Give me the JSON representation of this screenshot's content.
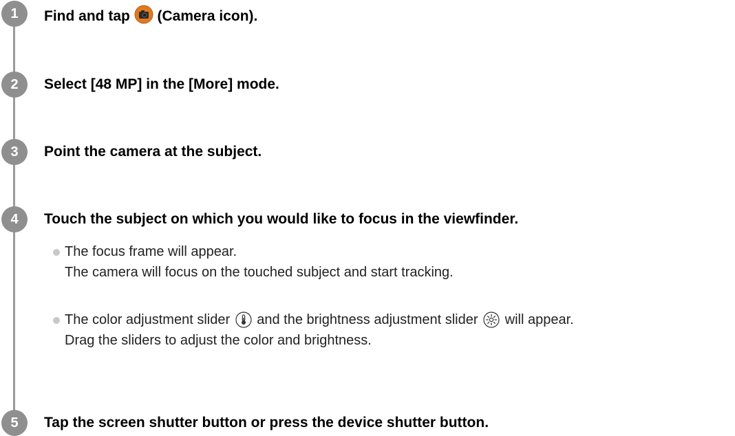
{
  "steps": [
    {
      "number": "1",
      "title_before": "Find and tap ",
      "title_icon": "camera-app-icon",
      "title_after": " (Camera icon)."
    },
    {
      "number": "2",
      "title": "Select [48 MP] in the [More] mode."
    },
    {
      "number": "3",
      "title": "Point the camera at the subject."
    },
    {
      "number": "4",
      "title": "Touch the subject on which you would like to focus in the viewfinder.",
      "bullets": [
        {
          "line1": "The focus frame will appear.",
          "line2": "The camera will focus on the touched subject and start tracking."
        },
        {
          "line1_part1": "The color adjustment slider ",
          "icon1": "thermometer-icon",
          "line1_part2": " and the brightness adjustment slider ",
          "icon2": "brightness-icon",
          "line1_part3": " will appear.",
          "line2": "Drag the sliders to adjust the color and brightness."
        }
      ]
    },
    {
      "number": "5",
      "title": "Tap the screen shutter button or press the device shutter button."
    }
  ],
  "colors": {
    "badge": "#8f8f8f",
    "timeline": "#9a9a9a",
    "bullet_dot": "#c8c8c8",
    "camera_icon_orange": "#e07a1f"
  }
}
